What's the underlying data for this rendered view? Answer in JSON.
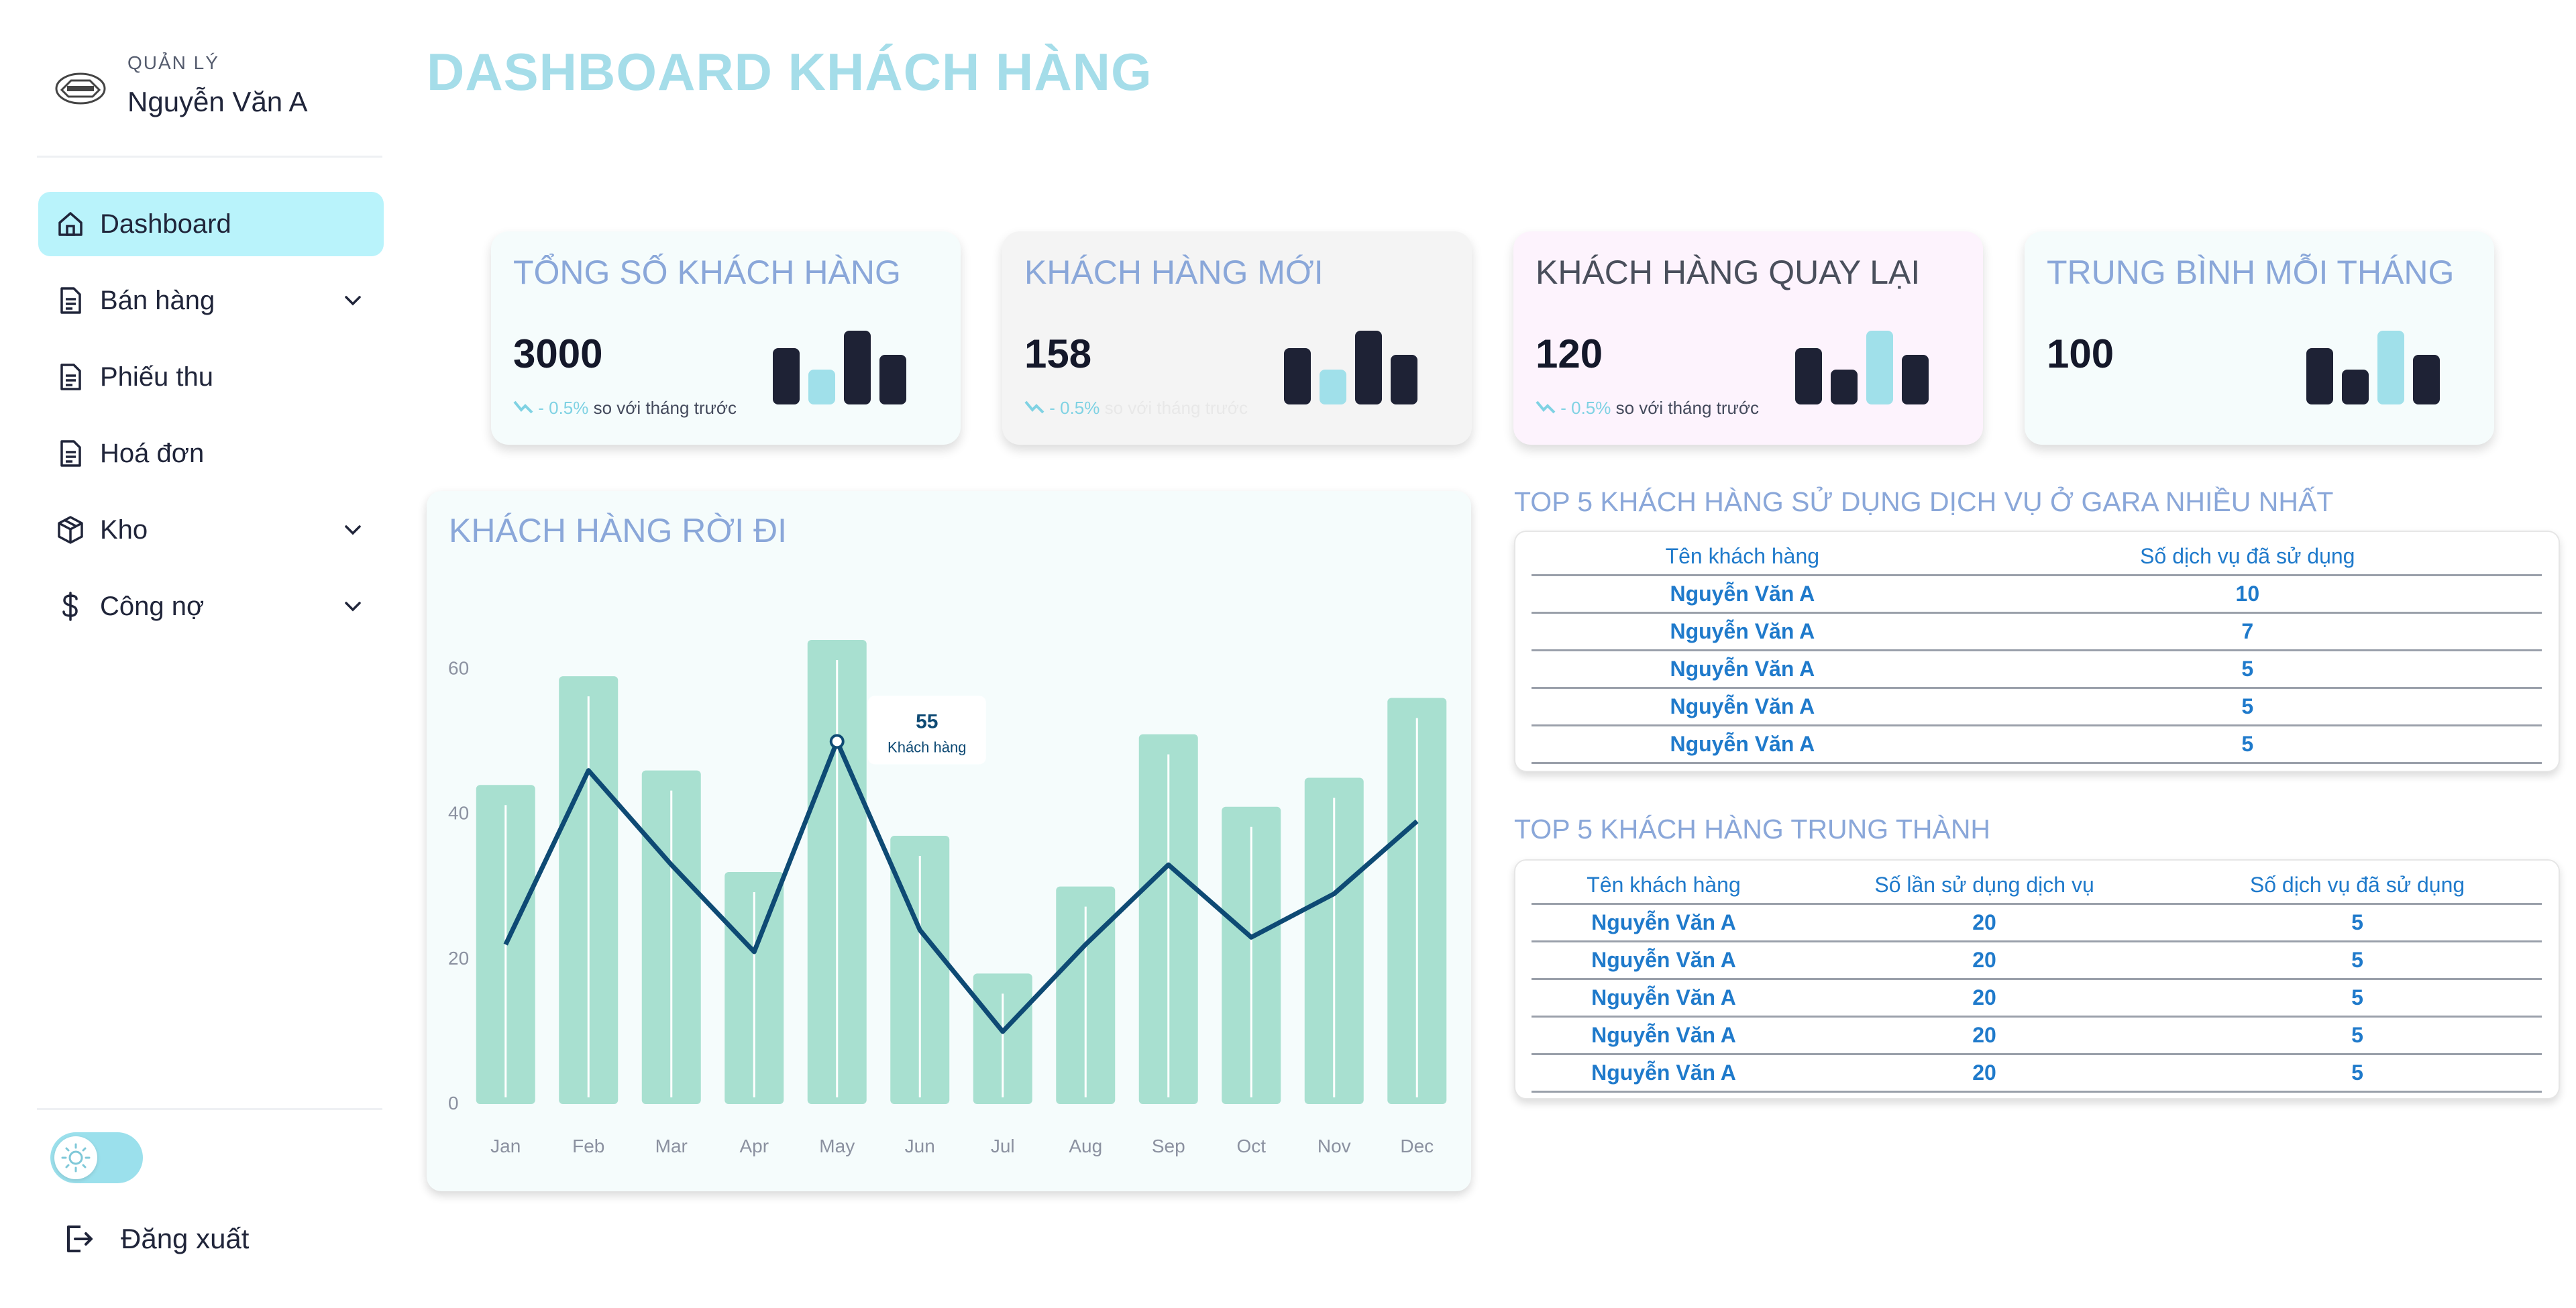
{
  "sidebar": {
    "role": "QUẢN LÝ",
    "user_name": "Nguyễn Văn A",
    "items": [
      {
        "label": "Dashboard",
        "icon": "home-icon",
        "active": true,
        "has_submenu": false
      },
      {
        "label": "Bán hàng",
        "icon": "document-icon",
        "active": false,
        "has_submenu": true
      },
      {
        "label": "Phiếu thu",
        "icon": "document-icon",
        "active": false,
        "has_submenu": false
      },
      {
        "label": "Hoá đơn",
        "icon": "document-icon",
        "active": false,
        "has_submenu": false
      },
      {
        "label": "Kho",
        "icon": "box-icon",
        "active": false,
        "has_submenu": true
      },
      {
        "label": "Công nợ",
        "icon": "dollar-icon",
        "active": false,
        "has_submenu": true
      }
    ],
    "logout_label": "Đăng xuất",
    "theme_toggle_icon": "sun-icon"
  },
  "page_title": "DASHBOARD KHÁCH HÀNG",
  "stat_cards": [
    {
      "title": "TỔNG SỐ KHÁCH HÀNG",
      "value": "3000",
      "trend_pct": "- 0.5%",
      "trend_text": "so với tháng trước",
      "bg": "#f5fcfc",
      "title_color": "#8aa7d9",
      "highlight_bar": 1
    },
    {
      "title": "KHÁCH HÀNG MỚI",
      "value": "158",
      "trend_pct": "- 0.5%",
      "trend_text": "so với tháng trước",
      "bg": "#f4f4f4",
      "title_color": "#8aa7d9",
      "highlight_bar": 1
    },
    {
      "title": "KHÁCH HÀNG QUAY LẠI",
      "value": "120",
      "trend_pct": "- 0.5%",
      "trend_text": "so với tháng trước",
      "bg": "#fdf3fd",
      "title_color": "#4a4f5c",
      "highlight_bar": 2
    },
    {
      "title": "TRUNG BÌNH MỖI THÁNG",
      "value": "100",
      "trend_pct": "",
      "trend_text": "",
      "bg": "#f5fcfc",
      "title_color": "#8aa7d9",
      "highlight_bar": 2
    }
  ],
  "colors": {
    "accent": "#a5dde9",
    "dark_bar": "#1e2235",
    "light_bar": "#a0e0ea",
    "bar_green": "#a8e0d0",
    "line": "#0e4a74"
  },
  "churn_chart": {
    "title": "KHÁCH HÀNG RỜI ĐI",
    "chart_data": {
      "type": "bar",
      "categories": [
        "Jan",
        "Feb",
        "Mar",
        "Apr",
        "May",
        "Jun",
        "Jul",
        "Aug",
        "Sep",
        "Oct",
        "Nov",
        "Dec"
      ],
      "series": [
        {
          "values": [
            44,
            59,
            46,
            32,
            64,
            37,
            18,
            30,
            51,
            41,
            45,
            56
          ]
        },
        {
          "values": [
            22,
            46,
            33,
            21,
            50,
            24,
            10,
            22,
            33,
            23,
            29,
            39
          ]
        }
      ],
      "ylim": [
        0,
        64
      ],
      "yticks": [
        0,
        20,
        40,
        60
      ],
      "tooltip": {
        "value": "55",
        "label": "Khách hàng"
      }
    }
  },
  "top_services": {
    "title": "TOP 5 KHÁCH HÀNG SỬ DỤNG DỊCH VỤ Ở GARA NHIỀU NHẤT",
    "headers": [
      "Tên khách hàng",
      "Số dịch vụ đã sử dụng"
    ],
    "rows": [
      [
        "Nguyễn Văn A",
        "10"
      ],
      [
        "Nguyễn Văn A",
        "7"
      ],
      [
        "Nguyễn Văn A",
        "5"
      ],
      [
        "Nguyễn Văn A",
        "5"
      ],
      [
        "Nguyễn Văn A",
        "5"
      ]
    ]
  },
  "top_loyal": {
    "title": "TOP 5 KHÁCH HÀNG TRUNG THÀNH",
    "headers": [
      "Tên khách hàng",
      "Số lần sử dụng dịch vụ",
      "Số dịch vụ đã sử dụng"
    ],
    "rows": [
      [
        "Nguyễn Văn A",
        "20",
        "5"
      ],
      [
        "Nguyễn Văn A",
        "20",
        "5"
      ],
      [
        "Nguyễn Văn A",
        "20",
        "5"
      ],
      [
        "Nguyễn Văn A",
        "20",
        "5"
      ],
      [
        "Nguyễn Văn A",
        "20",
        "5"
      ]
    ]
  }
}
